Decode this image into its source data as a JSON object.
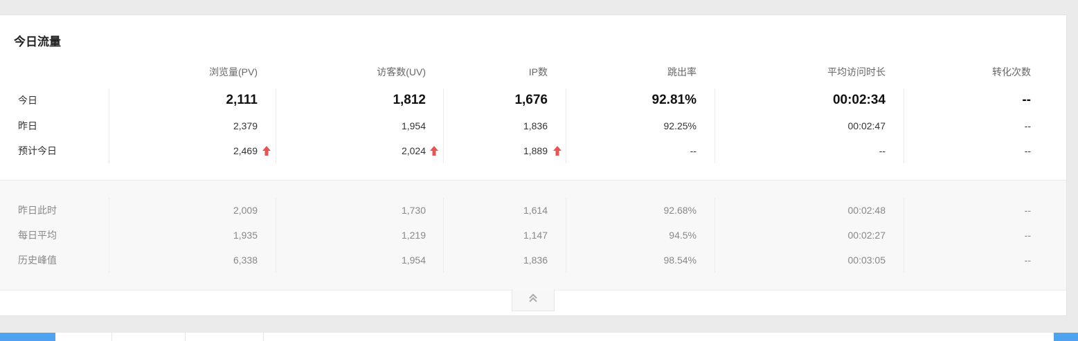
{
  "panel": {
    "title": "今日流量"
  },
  "columns": [
    "浏览量(PV)",
    "访客数(UV)",
    "IP数",
    "跳出率",
    "平均访问时长",
    "转化次数"
  ],
  "main_rows": [
    {
      "label": "今日",
      "values": [
        "2,111",
        "1,812",
        "1,676",
        "92.81%",
        "00:02:34",
        "--"
      ]
    },
    {
      "label": "昨日",
      "values": [
        "2,379",
        "1,954",
        "1,836",
        "92.25%",
        "00:02:47",
        "--"
      ]
    },
    {
      "label": "预计今日",
      "values": [
        "2,469",
        "2,024",
        "1,889",
        "--",
        "--",
        "--"
      ],
      "trend_up": [
        true,
        true,
        true,
        false,
        false,
        false
      ]
    }
  ],
  "history_rows": [
    {
      "label": "昨日此时",
      "values": [
        "2,009",
        "1,730",
        "1,614",
        "92.68%",
        "00:02:48",
        "--"
      ]
    },
    {
      "label": "每日平均",
      "values": [
        "1,935",
        "1,219",
        "1,147",
        "94.5%",
        "00:02:27",
        "--"
      ]
    },
    {
      "label": "历史峰值",
      "values": [
        "6,338",
        "1,954",
        "1,836",
        "98.54%",
        "00:03:05",
        "--"
      ]
    }
  ],
  "icons": {
    "trend": "arrow-up-icon",
    "collapse": "double-chevron-up-icon"
  },
  "colors": {
    "accent": "#4da3ee",
    "trend_up": "#e85454"
  }
}
